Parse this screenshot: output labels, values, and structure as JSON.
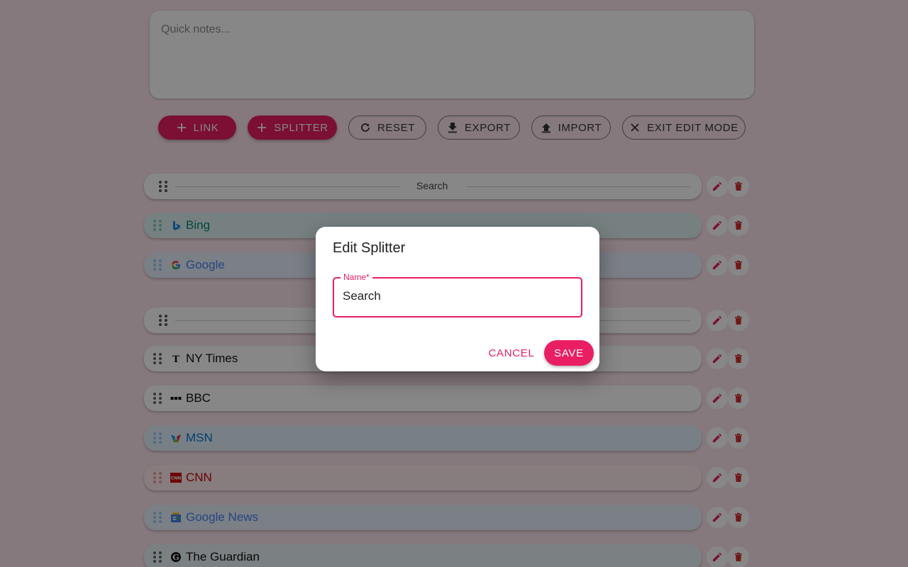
{
  "notes": {
    "placeholder": "Quick notes..."
  },
  "toolbar": {
    "link_label": "Link",
    "splitter_label": "Splitter",
    "reset_label": "Reset",
    "export_label": "Export",
    "import_label": "Import",
    "exit_label": "Exit edit mode"
  },
  "items": [
    {
      "kind": "splitter",
      "name": "Search"
    },
    {
      "kind": "link",
      "title": "Bing",
      "color": "#00897b",
      "bg": "#e0f2f1",
      "icon": "bing-icon"
    },
    {
      "kind": "link",
      "title": "Google",
      "color": "#4285f4",
      "bg": "#e8f0fe",
      "icon": "google-icon"
    },
    {
      "kind": "splitter",
      "name": ""
    },
    {
      "kind": "link",
      "title": "NY Times",
      "color": "#111111",
      "bg": "#ffffff",
      "icon": "nytimes-icon"
    },
    {
      "kind": "link",
      "title": "BBC",
      "color": "#111111",
      "bg": "#ffffff",
      "icon": "bbc-icon"
    },
    {
      "kind": "link",
      "title": "MSN",
      "color": "#0078d4",
      "bg": "#e3f2fd",
      "icon": "msn-icon"
    },
    {
      "kind": "link",
      "title": "CNN",
      "color": "#cc0000",
      "bg": "#ffebee",
      "icon": "cnn-icon"
    },
    {
      "kind": "link",
      "title": "Google News",
      "color": "#4285f4",
      "bg": "#e8f0fe",
      "icon": "google-news-icon"
    },
    {
      "kind": "link",
      "title": "The Guardian",
      "color": "#111111",
      "bg": "#e9f1f8",
      "icon": "guardian-icon"
    }
  ],
  "dialog": {
    "title": "Edit Splitter",
    "field_label": "Name",
    "required_mark": "*",
    "field_value": "Search",
    "cancel_label": "Cancel",
    "save_label": "Save"
  },
  "colors": {
    "accent": "#e91e63",
    "delete": "#d32f2f",
    "background": "#fce4ec"
  }
}
